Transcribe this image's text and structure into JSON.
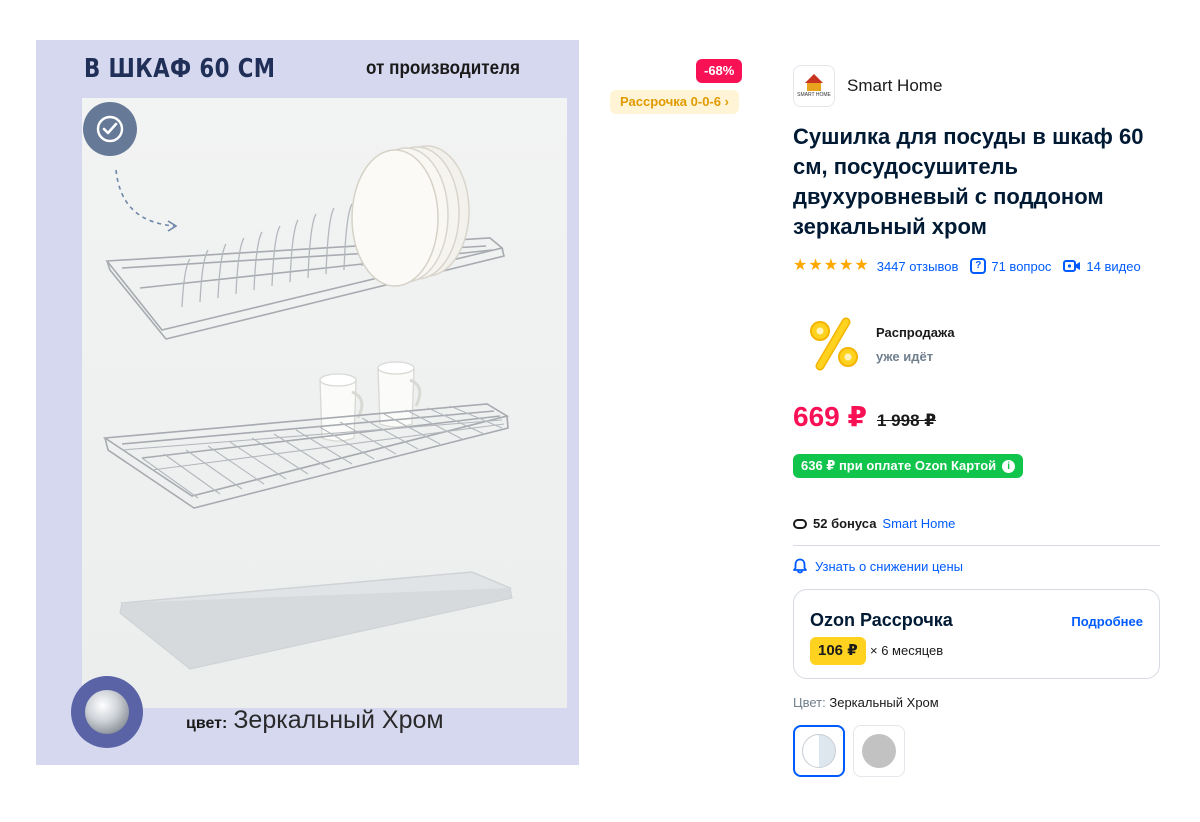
{
  "product_image": {
    "headline": "В ШКАФ 60 СМ",
    "manufacturer": "от производителя",
    "color_caption_label": "цвет:",
    "color_caption_value": "Зеркальный Хром"
  },
  "badges": {
    "discount": "-68%",
    "installment": "Рассрочка 0-0-6 ›"
  },
  "brand": {
    "name": "Smart Home",
    "logo_text": "SMART HOME",
    "logo_icon": "brand-logo-icon"
  },
  "product": {
    "title": "Сушилка для посуды в шкаф 60 см, посудосушитель двухуровневый с поддоном зеркальный хром"
  },
  "meta": {
    "rating": 5,
    "reviews": "3447 отзывов",
    "questions": "71 вопрос",
    "videos": "14 видео",
    "question_icon": "question-icon",
    "video_icon": "video-icon"
  },
  "sale": {
    "title": "Распродажа",
    "subtitle": "уже идёт",
    "icon": "percent-icon"
  },
  "price": {
    "current": "669 ₽",
    "old": "1 998 ₽",
    "card_price": "636 ₽ при оплате Ozon Картой"
  },
  "bonus": {
    "count": "52 бонуса",
    "seller": "Smart Home"
  },
  "price_alert": {
    "label": "Узнать о снижении цены"
  },
  "installment_card": {
    "title": "Ozon Рассрочка",
    "more": "Подробнее",
    "amount": "106 ₽",
    "term": "× 6 месяцев"
  },
  "color": {
    "label": "Цвет:",
    "value": "Зеркальный Хром",
    "options": [
      "Зеркальный Хром",
      "Серый"
    ],
    "selected": 0
  },
  "colors": {
    "accent": "#005bff",
    "price": "#f91155",
    "ozon_card": "#10c44c",
    "installment_amount": "#ffd21f",
    "star": "#ffa800"
  }
}
